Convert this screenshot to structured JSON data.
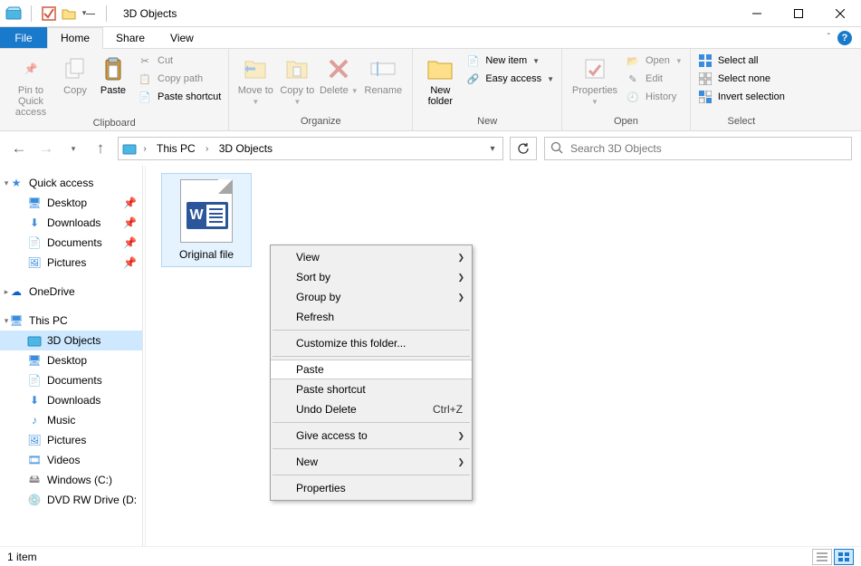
{
  "window": {
    "title": "3D Objects"
  },
  "qat": {
    "check_state": "checked"
  },
  "tabs": {
    "file": "File",
    "home": "Home",
    "share": "Share",
    "view": "View"
  },
  "ribbon": {
    "clipboard": {
      "label": "Clipboard",
      "pin": "Pin to Quick access",
      "copy": "Copy",
      "paste": "Paste",
      "cut": "Cut",
      "copy_path": "Copy path",
      "paste_shortcut": "Paste shortcut"
    },
    "organize": {
      "label": "Organize",
      "move_to": "Move to",
      "copy_to": "Copy to",
      "delete": "Delete",
      "rename": "Rename"
    },
    "new": {
      "label": "New",
      "new_folder": "New folder",
      "new_item": "New item",
      "easy_access": "Easy access"
    },
    "open": {
      "label": "Open",
      "properties": "Properties",
      "open": "Open",
      "edit": "Edit",
      "history": "History"
    },
    "select": {
      "label": "Select",
      "select_all": "Select all",
      "select_none": "Select none",
      "invert": "Invert selection"
    }
  },
  "breadcrumb": {
    "seg1": "This PC",
    "seg2": "3D Objects"
  },
  "search": {
    "placeholder": "Search 3D Objects"
  },
  "nav": {
    "quick_access": "Quick access",
    "desktop": "Desktop",
    "downloads": "Downloads",
    "documents": "Documents",
    "pictures": "Pictures",
    "onedrive": "OneDrive",
    "this_pc": "This PC",
    "objects3d": "3D Objects",
    "desktop2": "Desktop",
    "documents2": "Documents",
    "downloads2": "Downloads",
    "music": "Music",
    "pictures2": "Pictures",
    "videos": "Videos",
    "cdrive": "Windows  (C:)",
    "dvd": "DVD RW Drive (D:)"
  },
  "file": {
    "name": "Original file"
  },
  "context": {
    "view": "View",
    "sort_by": "Sort by",
    "group_by": "Group by",
    "refresh": "Refresh",
    "customize": "Customize this folder...",
    "paste": "Paste",
    "paste_shortcut": "Paste shortcut",
    "undo_delete": "Undo Delete",
    "undo_hotkey": "Ctrl+Z",
    "give_access": "Give access to",
    "new": "New",
    "properties": "Properties"
  },
  "status": {
    "count": "1 item"
  }
}
